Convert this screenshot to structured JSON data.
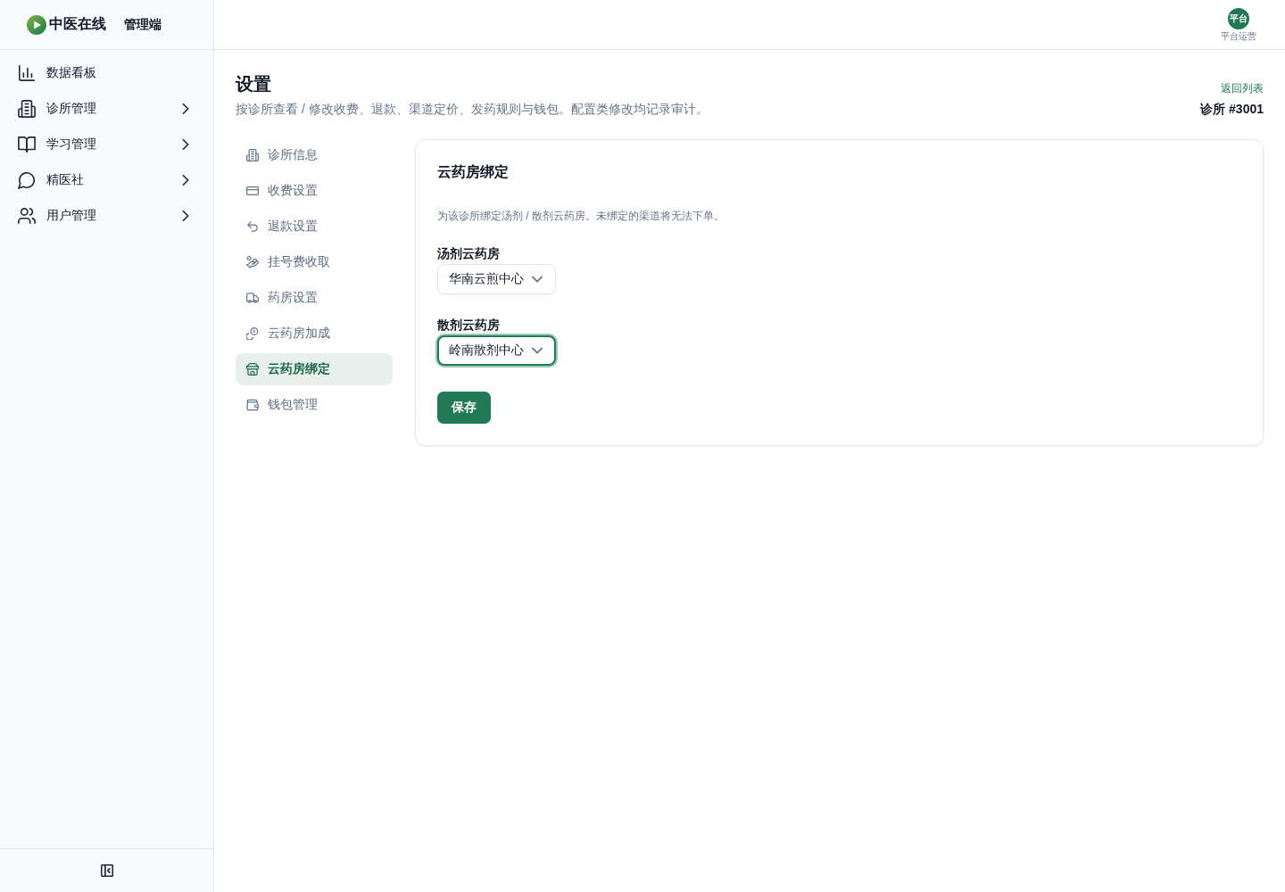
{
  "sidebar": {
    "brand": {
      "name": "中医在线",
      "subtitle": "管理端"
    },
    "items": [
      {
        "label": "数据看板",
        "has_submenu": false
      },
      {
        "label": "诊所管理",
        "has_submenu": true
      },
      {
        "label": "学习管理",
        "has_submenu": true
      },
      {
        "label": "精医社",
        "has_submenu": true
      },
      {
        "label": "用户管理",
        "has_submenu": true
      }
    ]
  },
  "top_bar": {
    "user": {
      "avatar_text": "平台",
      "role": "平台运营"
    }
  },
  "page": {
    "title": "设置",
    "subtitle": "按诊所查看 / 修改收费、退款、渠道定价、发药规则与钱包。配置类修改均记录审计。",
    "back_link": "返回列表",
    "clinic": "诊所 #3001"
  },
  "settings_nav": {
    "items": [
      {
        "label": "诊所信息",
        "selected": false
      },
      {
        "label": "收费设置",
        "selected": false
      },
      {
        "label": "退款设置",
        "selected": false
      },
      {
        "label": "挂号费收取",
        "selected": false
      },
      {
        "label": "药房设置",
        "selected": false
      },
      {
        "label": "云药房加成",
        "selected": false
      },
      {
        "label": "云药房绑定",
        "selected": true
      },
      {
        "label": "钱包管理",
        "selected": false
      }
    ]
  },
  "card": {
    "title": "云药房绑定",
    "description": "为该诊所绑定汤剂 / 散剂云药房。未绑定的渠道将无法下单。",
    "fields": [
      {
        "label": "汤剂云药房",
        "value": "华南云煎中心",
        "focused": false
      },
      {
        "label": "散剂云药房",
        "value": "岭南散剂中心",
        "focused": true
      }
    ],
    "save_button": "保存"
  }
}
